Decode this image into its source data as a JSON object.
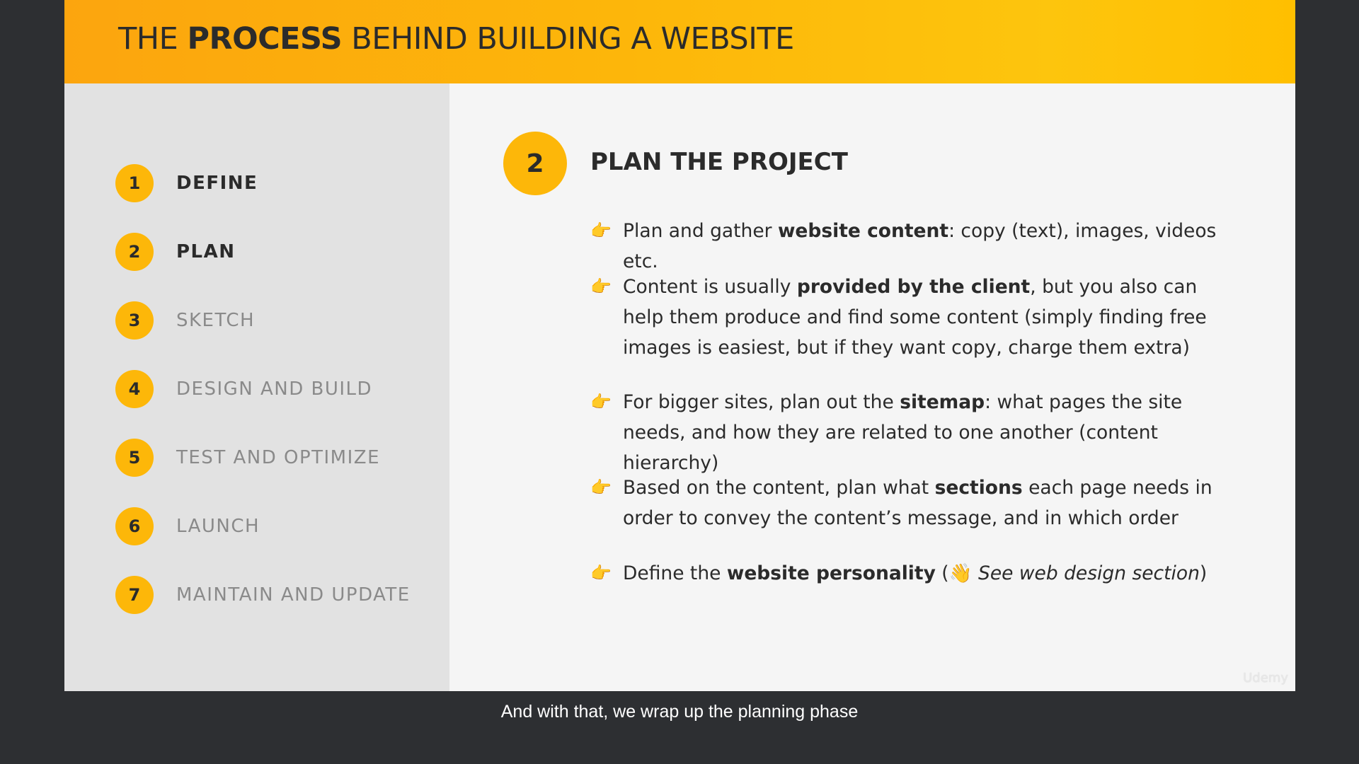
{
  "slide": {
    "title_pre": "THE ",
    "title_bold": "PROCESS",
    "title_post": " BEHIND BUILDING A WEBSITE",
    "accent_color": "#fdb709",
    "steps": [
      {
        "num": "1",
        "label": "DEFINE",
        "state": "done"
      },
      {
        "num": "2",
        "label": "PLAN",
        "state": "current"
      },
      {
        "num": "3",
        "label": "SKETCH",
        "state": "upcoming"
      },
      {
        "num": "4",
        "label": "DESIGN AND BUILD",
        "state": "upcoming"
      },
      {
        "num": "5",
        "label": "TEST AND OPTIMIZE",
        "state": "upcoming"
      },
      {
        "num": "6",
        "label": "LAUNCH",
        "state": "upcoming"
      },
      {
        "num": "7",
        "label": "MAINTAIN AND UPDATE",
        "state": "upcoming"
      }
    ],
    "section": {
      "number": "2",
      "title": "PLAN THE PROJECT"
    },
    "bullets": [
      {
        "pre": "Plan and gather ",
        "bold": "website content",
        "post": ": copy (text), images, videos etc."
      },
      {
        "pre": "Content is usually ",
        "bold": "provided by the client",
        "post": ", but you also can help them produce and find some content (simply finding free images is easiest, but if they want copy, charge them extra)"
      },
      {
        "pre": "For bigger sites, plan out the ",
        "bold": "sitemap",
        "post": ": what pages the site needs, and how they are related to one another (content hierarchy)"
      },
      {
        "pre": "Based on the content, plan what ",
        "bold": "sections",
        "post": " each page needs in order to convey the content’s message, and in which order"
      },
      {
        "pre": "Define the ",
        "bold": "website personality",
        "post": " (",
        "emoji": "👋",
        "italic": " See web design section",
        "close": ")"
      }
    ],
    "bullet_icon": "pointing-hand-icon",
    "watermark": "Udemy"
  },
  "caption": "And with that, we wrap up the planning phase"
}
